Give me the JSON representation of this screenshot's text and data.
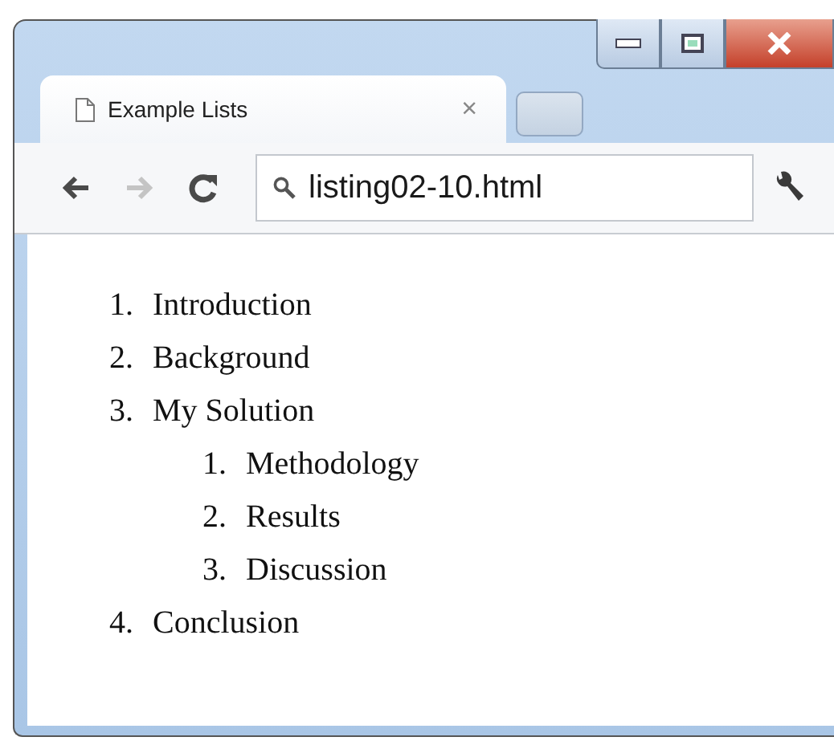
{
  "tabs": [
    {
      "title": "Example Lists",
      "close": "×",
      "selected": true
    }
  ],
  "toolbar": {
    "address": "listing02-10.html",
    "forward_disabled": true
  },
  "content": {
    "items": [
      {
        "number": "1.",
        "text": "Introduction"
      },
      {
        "number": "2.",
        "text": "Background"
      },
      {
        "number": "3.",
        "text": "My Solution",
        "children": [
          {
            "number": "1.",
            "text": "Methodology"
          },
          {
            "number": "2.",
            "text": "Results"
          },
          {
            "number": "3.",
            "text": "Discussion"
          }
        ]
      },
      {
        "number": "4.",
        "text": "Conclusion"
      }
    ]
  }
}
